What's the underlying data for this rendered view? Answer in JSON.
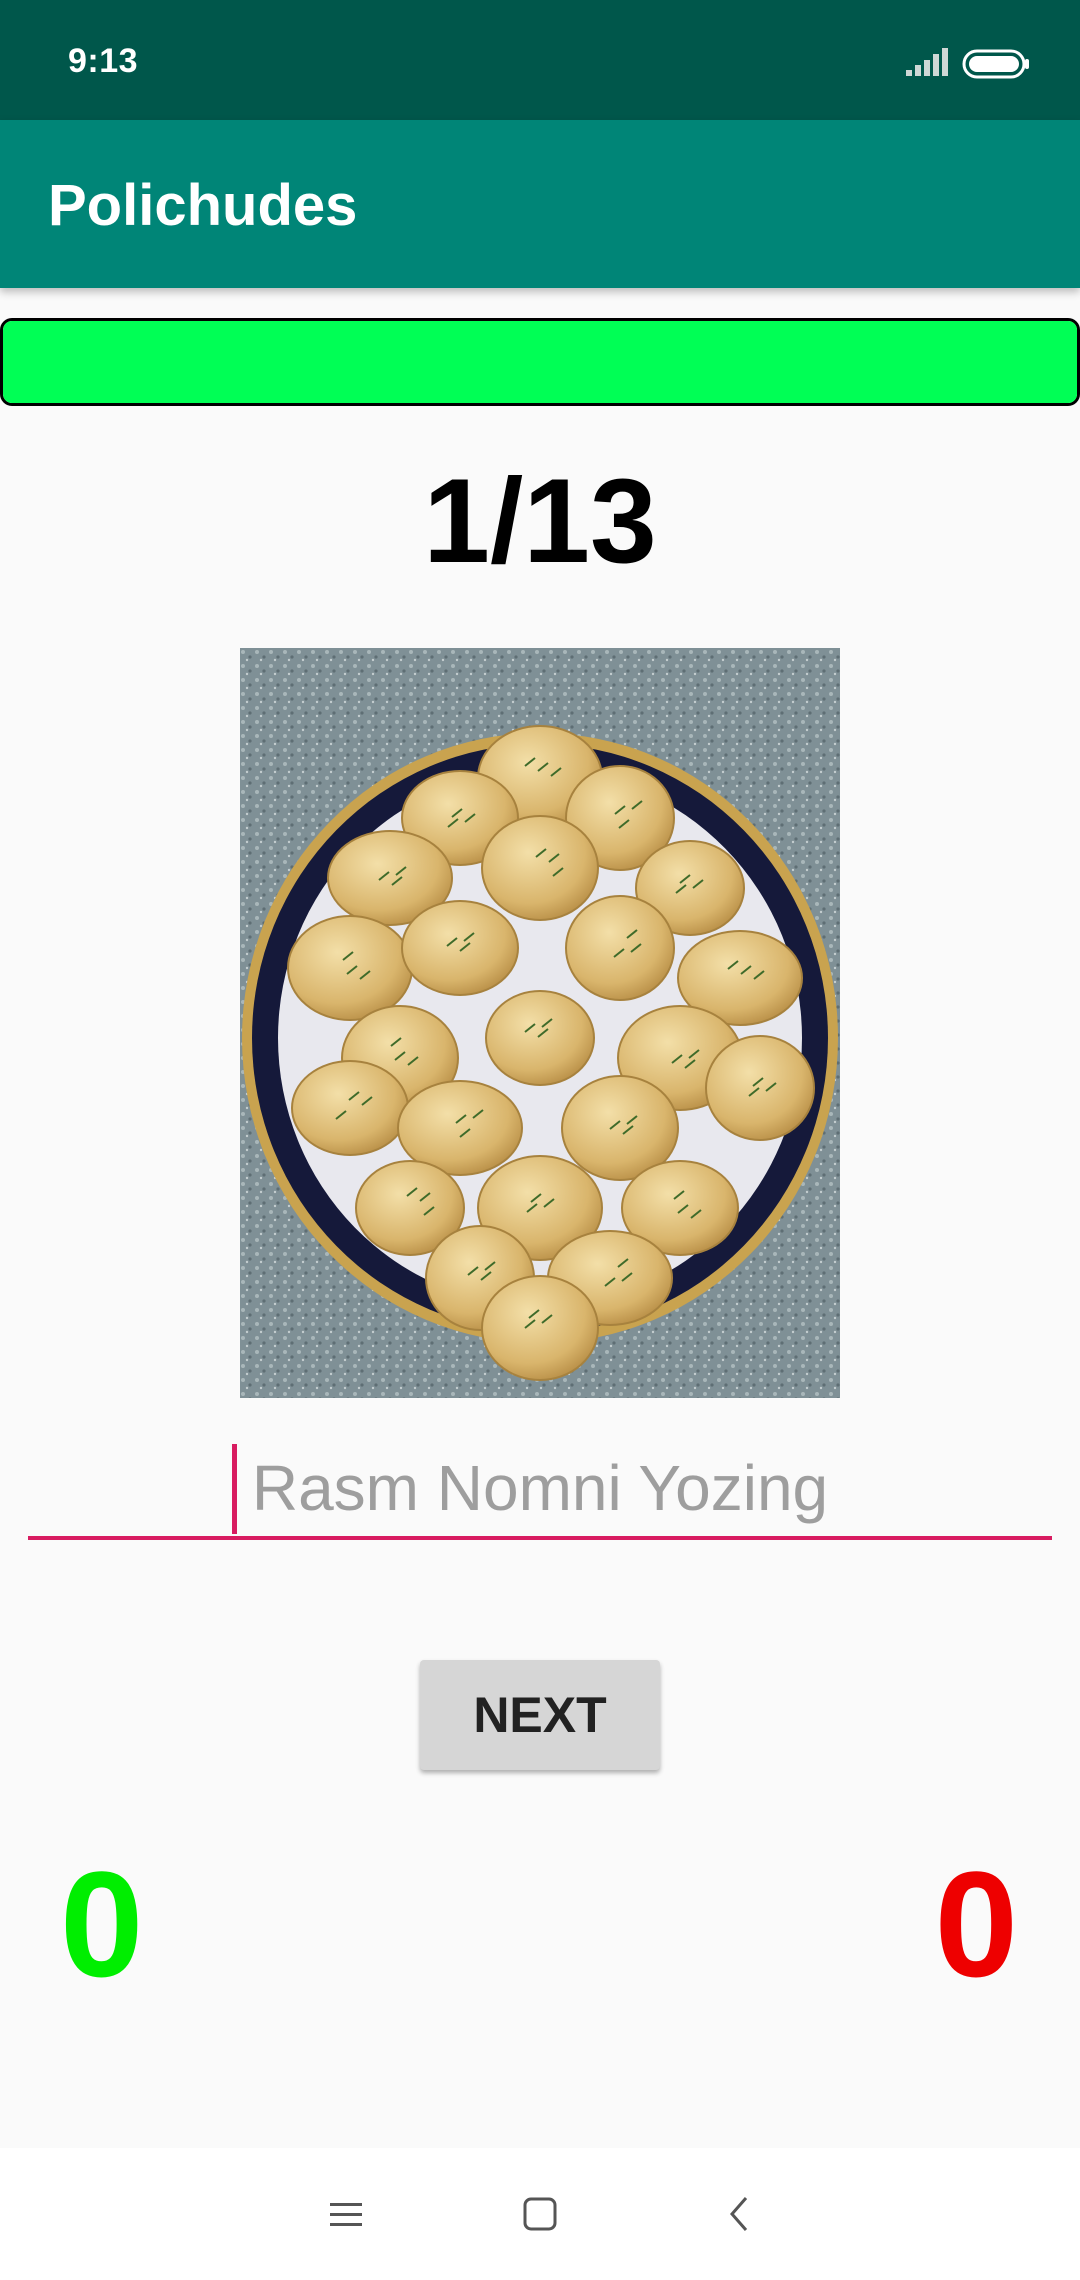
{
  "status_bar": {
    "time": "9:13",
    "signal_icon": "signal-icon",
    "battery_icon": "battery-icon"
  },
  "app_bar": {
    "title": "Polichudes",
    "color": "#008577"
  },
  "progress": {
    "fraction": 1.0,
    "color": "#00ff55"
  },
  "question": {
    "counter": "1/13",
    "image_subject": "plate of manti dumplings with dill"
  },
  "answer": {
    "value": "",
    "placeholder": "Rasm Nomni Yozing"
  },
  "next_button": {
    "label": "NEXT"
  },
  "scores": {
    "correct": "0",
    "wrong": "0",
    "correct_color": "#00ee00",
    "wrong_color": "#ee0000"
  },
  "nav_bar": {
    "icons": [
      "menu-icon",
      "home-icon",
      "back-icon"
    ]
  }
}
